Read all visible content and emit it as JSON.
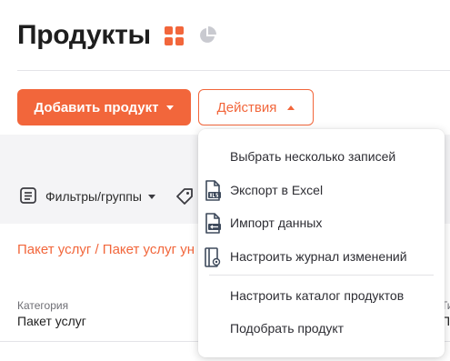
{
  "header": {
    "title": "Продукты",
    "view_icons": [
      "grid-view-icon",
      "chart-view-icon"
    ],
    "add_button_label": "Добавить продукт",
    "actions_button_label": "Действия"
  },
  "actions_menu": {
    "items": [
      {
        "label": "Выбрать несколько записей",
        "icon": null
      },
      {
        "label": "Экспорт в Excel",
        "icon": "xls-export-icon"
      },
      {
        "label": "Импорт данных",
        "icon": "import-icon"
      },
      {
        "label": "Настроить журнал изменений",
        "icon": "change-log-icon"
      },
      {
        "label": "Настроить каталог продуктов",
        "icon": null
      },
      {
        "label": "Подобрать продукт",
        "icon": null
      }
    ]
  },
  "filters": {
    "label": "Фильтры/группы",
    "icons": [
      "filter-icon",
      "tag-icon"
    ]
  },
  "record": {
    "breadcrumb": "Пакет услуг / Пакет услуг ун",
    "category_label": "Категория",
    "category_value": "Пакет услуг",
    "partial_label": "Ти",
    "partial_value": "Па"
  },
  "colors": {
    "accent": "#f2663b",
    "background": "#f4f4f6"
  }
}
